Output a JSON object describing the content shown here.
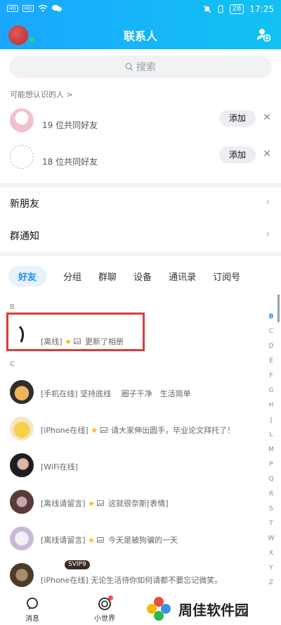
{
  "status_bar": {
    "time": "17:25",
    "battery": "28",
    "sim1": "HD",
    "sim2": "HD"
  },
  "header": {
    "title": "联系人"
  },
  "search": {
    "placeholder": "搜索"
  },
  "recommend": {
    "label": "可能想认识的人 >",
    "items": [
      {
        "mutual": "19 位共同好友",
        "add": "添加"
      },
      {
        "mutual": "18 位共同好友",
        "add": "添加"
      }
    ]
  },
  "menu": [
    {
      "label": "新朋友"
    },
    {
      "label": "群通知"
    }
  ],
  "tabs": [
    {
      "label": "好友",
      "active": true
    },
    {
      "label": "分组"
    },
    {
      "label": "群聊"
    },
    {
      "label": "设备"
    },
    {
      "label": "通讯录"
    },
    {
      "label": "订阅号"
    }
  ],
  "sections": [
    {
      "letter": "B",
      "contacts": [
        {
          "status": "[离线]",
          "text": "更新了相册"
        }
      ]
    },
    {
      "letter": "C",
      "contacts": [
        {
          "status": "[手机在线]",
          "text": "坚持底线　 圈子干净　生活简单"
        },
        {
          "status": "[iPhone在线]",
          "text": "请大家伸出圆手，毕业论文拜托了！"
        },
        {
          "status": "[WiFi在线]",
          "text": ""
        },
        {
          "status": "[离线请留言]",
          "text": "这就很奈斯[表情]"
        },
        {
          "status": "[离线请留言]",
          "text": "今天是被狗骗的一天"
        },
        {
          "status": "[iPhone在线]",
          "text": "无论生活待你如何请都不要忘记微笑。"
        }
      ]
    }
  ],
  "svip_badge": "SVIP9",
  "index_letters": [
    "B",
    "C",
    "D",
    "E",
    "F",
    "G",
    "H",
    "J",
    "L",
    "M",
    "P",
    "Q",
    "R",
    "S",
    "T",
    "W",
    "X",
    "Y",
    "Z",
    "#"
  ],
  "bottom_nav": [
    {
      "label": "消息"
    },
    {
      "label": "小世界"
    }
  ],
  "watermark": "周佳软件园",
  "colors": {
    "accent": "#1a8cff",
    "header": "#12b6f8",
    "highlight": "#d93b3b"
  }
}
